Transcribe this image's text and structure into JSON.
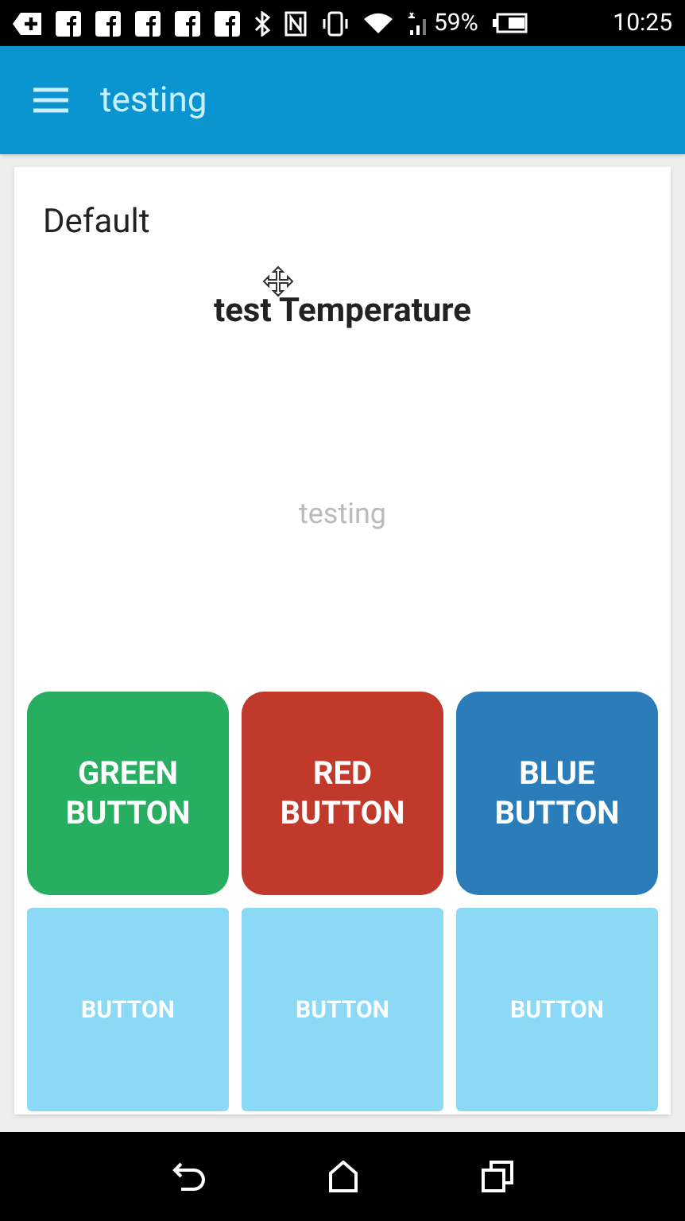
{
  "status_bar": {
    "battery": "59%",
    "time": "10:25"
  },
  "app_bar": {
    "title": "testing"
  },
  "card": {
    "title": "Default",
    "heading": "test Temperature",
    "value": "testing",
    "buttons": [
      {
        "label": "GREEN BUTTON",
        "kind": "rounded",
        "color": "#27ae60"
      },
      {
        "label": "RED BUTTON",
        "kind": "rounded",
        "color": "#c0392b"
      },
      {
        "label": "BLUE BUTTON",
        "kind": "rounded",
        "color": "#2a7db8"
      },
      {
        "label": "BUTTON",
        "kind": "square",
        "color": "#8cd9f5"
      },
      {
        "label": "BUTTON",
        "kind": "square",
        "color": "#8cd9f5"
      },
      {
        "label": "BUTTON",
        "kind": "square",
        "color": "#8cd9f5"
      }
    ]
  }
}
